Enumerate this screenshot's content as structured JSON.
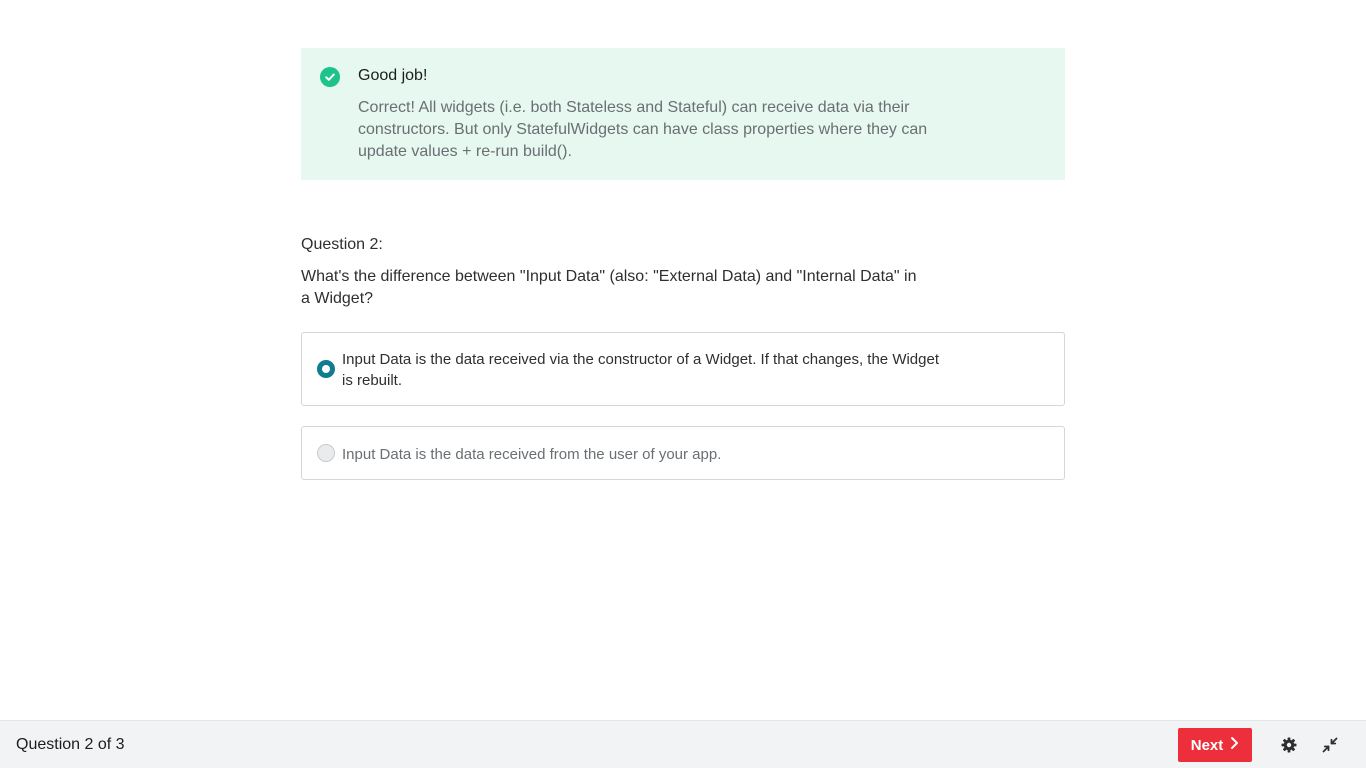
{
  "feedback": {
    "status": "success",
    "icon": "check-circle-icon",
    "accent_color": "#1ec28b",
    "title": "Good job!",
    "message": "Correct! All widgets (i.e. both Stateless and Stateful) can receive data via their constructors. But only StatefulWidgets can have class properties where they can update values + re-run build()."
  },
  "question": {
    "label": "Question 2:",
    "text": "What's the difference between \"Input Data\" (also: \"External Data) and \"Internal Data\" in a Widget?",
    "answers": [
      {
        "text": "Input Data is the data received via the constructor of a Widget. If that changes, the Widget is rebuilt.",
        "selected": true
      },
      {
        "text": "Input Data is the data received from the user of your app.",
        "selected": false
      }
    ]
  },
  "footer": {
    "progress": "Question 2 of 3",
    "next_label": "Next",
    "next_color": "#ec2f3a",
    "icons": [
      "chevron-right-icon",
      "gear-icon",
      "collapse-icon"
    ]
  }
}
